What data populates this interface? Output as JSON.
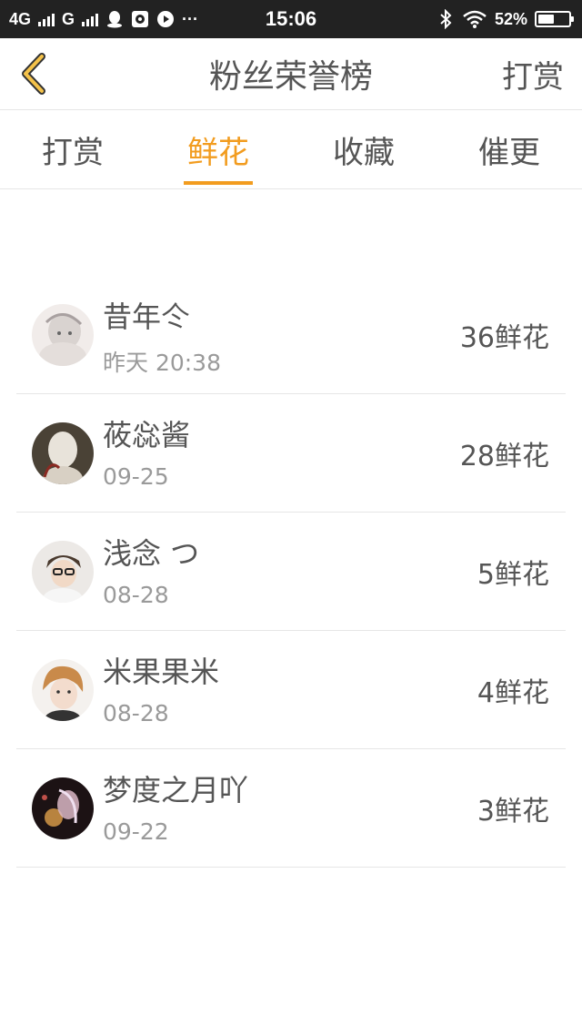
{
  "status_bar": {
    "network_1": "4G",
    "network_2": "G",
    "time": "15:06",
    "battery_percent": "52%",
    "battery_level": 0.52,
    "icons": [
      "signal-icon",
      "qq-icon",
      "album-icon",
      "video-icon",
      "more-icon",
      "bluetooth-icon",
      "wifi-icon",
      "battery-icon"
    ],
    "more": "···"
  },
  "header": {
    "title": "粉丝荣誉榜",
    "action": "打赏",
    "back_icon": "chevron-left-icon",
    "accent": "#f29c1f"
  },
  "tabs": [
    {
      "label": "打赏",
      "active": false
    },
    {
      "label": "鲜花",
      "active": true
    },
    {
      "label": "收藏",
      "active": false
    },
    {
      "label": "催更",
      "active": false
    }
  ],
  "fans": [
    {
      "name": "昔年仒",
      "time": "昨天 20:38",
      "amount": "36鲜花"
    },
    {
      "name": "莜惢酱",
      "time": "09-25",
      "amount": "28鲜花"
    },
    {
      "name": "浅念 つ",
      "time": "08-28",
      "amount": "5鲜花"
    },
    {
      "name": "米果果米",
      "time": "08-28",
      "amount": "4鲜花"
    },
    {
      "name": "梦度之月吖",
      "time": "09-22",
      "amount": "3鲜花"
    }
  ],
  "colors": {
    "accent": "#f29c1f",
    "text": "#555555",
    "subtext": "#9a9a9a",
    "divider": "#e6e6e6",
    "status_bar": "#222222"
  }
}
